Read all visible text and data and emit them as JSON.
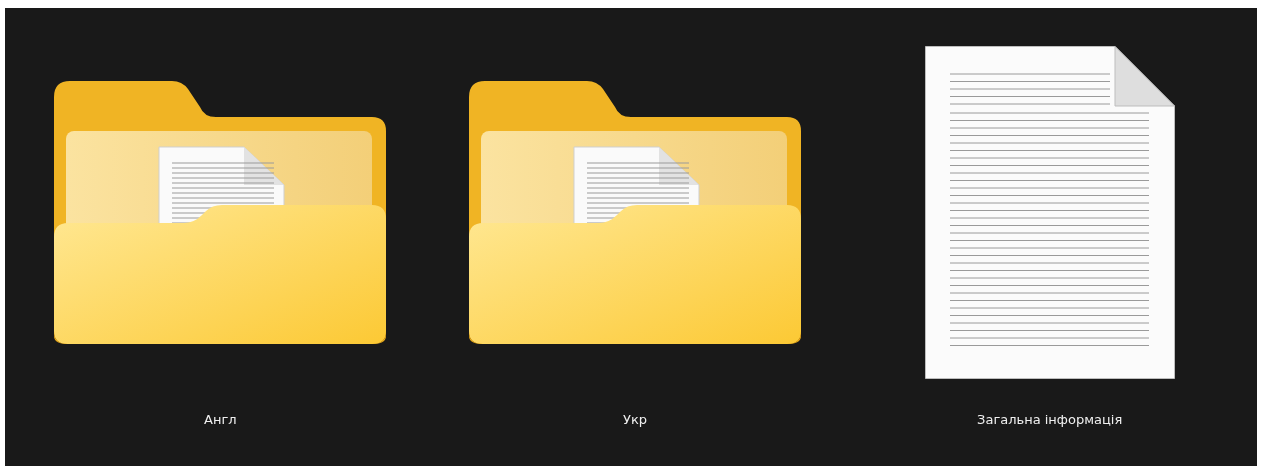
{
  "items": [
    {
      "kind": "folder",
      "name": "Англ",
      "selected": false
    },
    {
      "kind": "folder",
      "name": "Укр",
      "selected": false
    },
    {
      "kind": "document",
      "name": "Загальна інформація",
      "selected": false
    }
  ]
}
